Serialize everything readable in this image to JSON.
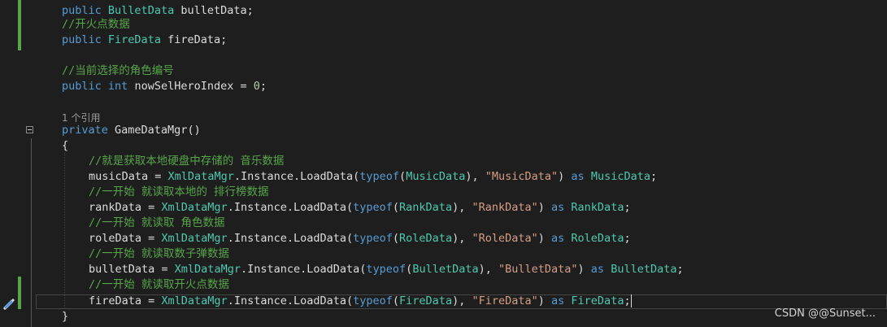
{
  "lines": {
    "l1": {
      "kw": "public",
      "ty": "BulletData",
      "rest": " bulletData;"
    },
    "l2": {
      "comment": "//开火点数据"
    },
    "l3": {
      "kw": "public",
      "ty": "FireData",
      "rest": " fireData;"
    },
    "l5": {
      "comment": "//当前选择的角色编号"
    },
    "l6": {
      "kw1": "public",
      "kw2": "int",
      "rest": " nowSelHeroIndex = ",
      "num": "0",
      "end": ";"
    },
    "l8": {
      "lens": "1 个引用"
    },
    "l9": {
      "kw": "private",
      "rest": " GameDataMgr()"
    },
    "l10": {
      "text": "{"
    },
    "l11": {
      "comment": "//就是获取本地硬盘中存储的 音乐数据"
    },
    "l12": {
      "a": "musicData = ",
      "t1": "XmlDataMgr",
      "b": ".Instance.LoadData(",
      "kw": "typeof",
      "c": "(",
      "t2": "MusicData",
      "d": "), ",
      "str": "\"MusicData\"",
      "e": ") ",
      "as": "as",
      "f": " ",
      "t3": "MusicData",
      "g": ";"
    },
    "l13": {
      "comment": "//一开始 就读取本地的 排行榜数据"
    },
    "l14": {
      "a": "rankData = ",
      "t1": "XmlDataMgr",
      "b": ".Instance.LoadData(",
      "kw": "typeof",
      "c": "(",
      "t2": "RankData",
      "d": "), ",
      "str": "\"RankData\"",
      "e": ") ",
      "as": "as",
      "f": " ",
      "t3": "RankData",
      "g": ";"
    },
    "l15": {
      "comment": "//一开始 就读取 角色数据"
    },
    "l16": {
      "a": "roleData = ",
      "t1": "XmlDataMgr",
      "b": ".Instance.LoadData(",
      "kw": "typeof",
      "c": "(",
      "t2": "RoleData",
      "d": "), ",
      "str": "\"RoleData\"",
      "e": ") ",
      "as": "as",
      "f": " ",
      "t3": "RoleData",
      "g": ";"
    },
    "l17": {
      "comment": "//一开始 就读取数子弹数据"
    },
    "l18": {
      "a": "bulletData = ",
      "t1": "XmlDataMgr",
      "b": ".Instance.LoadData(",
      "kw": "typeof",
      "c": "(",
      "t2": "BulletData",
      "d": "), ",
      "str": "\"BulletData\"",
      "e": ") ",
      "as": "as",
      "f": " ",
      "t3": "BulletData",
      "g": ";"
    },
    "l19": {
      "comment": "//一开始 就读取开火点数据"
    },
    "l20": {
      "a": "fireData = ",
      "t1": "XmlDataMgr",
      "b": ".Instance.LoadData(",
      "kw": "typeof",
      "c": "(",
      "t2": "FireData",
      "d": "), ",
      "str": "\"FireData\"",
      "e": ") ",
      "as": "as",
      "f": " ",
      "t3": "FireData",
      "g": ";"
    },
    "l21": {
      "text": "}"
    }
  },
  "watermark": "CSDN @@Sunset...",
  "colors": {
    "background": "#1e1e1e",
    "keyword": "#569cd6",
    "type": "#4ec9b0",
    "comment": "#57a64a",
    "string": "#d69d85",
    "number": "#b5cea8",
    "text": "#dcdcdc",
    "change_bar": "#57a64a"
  },
  "icons": {
    "fold": "collapse-minus-icon",
    "edit": "pencil-brush-icon"
  }
}
